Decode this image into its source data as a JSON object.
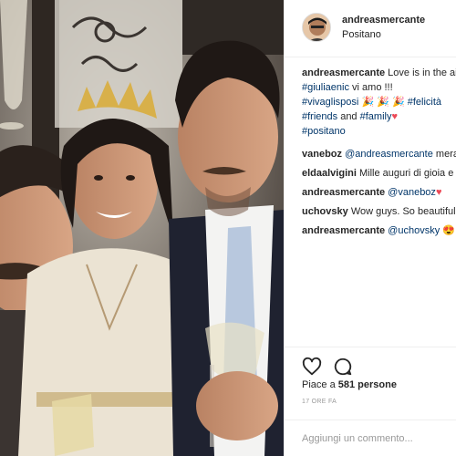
{
  "post": {
    "username": "andreasmercante",
    "location": "Positano"
  },
  "caption": {
    "username": "andreasmercante",
    "text": "Love is in the air",
    "tag_giulia": "#giuliaenic",
    "text2": " vi amo !!!",
    "tag_viva": "#vivaglisposi",
    "tag_felicita": "#felicità",
    "tag_friends": "#friends",
    "and": " and ",
    "tag_family": "#family",
    "tag_positano": "#positano"
  },
  "comments": [
    {
      "username": "vaneboz",
      "mention": "@andreasmercante",
      "text": " meravigliosi"
    },
    {
      "username": "eldaalvigini",
      "text": "Mille auguri di gioia e felicità"
    },
    {
      "username": "andreasmercante",
      "mention": "@vaneboz",
      "text": ""
    },
    {
      "username": "uchovsky",
      "text": "Wow guys. So beautiful"
    },
    {
      "username": "andreasmercante",
      "mention": "@uchovsky",
      "text": ""
    }
  ],
  "likes": {
    "prefix": "Piace a ",
    "count": "581 persone"
  },
  "timestamp": "17 ORE FA",
  "add_comment": {
    "placeholder": "Aggiungi un commento..."
  },
  "icons": {
    "like": "heart-outline-icon",
    "comment": "speech-bubble-icon"
  },
  "colors": {
    "link": "#003569",
    "heart": "#ed4956",
    "muted": "#999999"
  }
}
